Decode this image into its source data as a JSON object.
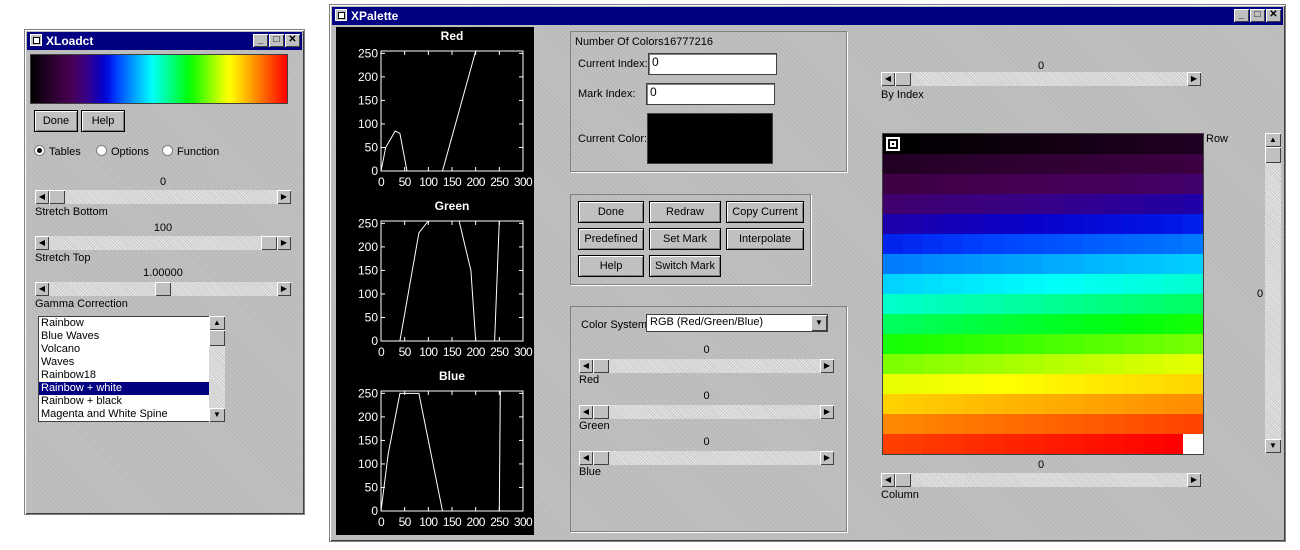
{
  "xloadct": {
    "title": "XLoadct",
    "done_label": "Done",
    "help_label": "Help",
    "radio_tables": "Tables",
    "radio_options": "Options",
    "radio_function": "Function",
    "selected_radio": "Tables",
    "stretch_bottom": {
      "value": "0",
      "label": "Stretch Bottom",
      "fraction": 0.0
    },
    "stretch_top": {
      "value": "100",
      "label": "Stretch Top",
      "fraction": 1.0
    },
    "gamma": {
      "value": "1.00000",
      "label": "Gamma Correction",
      "fraction": 0.5
    },
    "tables": [
      "Rainbow",
      "Blue Waves",
      "Volcano",
      "Waves",
      "Rainbow18",
      "Rainbow + white",
      "Rainbow + black",
      "Magenta and White Spine"
    ],
    "selected_table": "Rainbow + white"
  },
  "xpalette": {
    "title": "XPalette",
    "number_of_colors_label": "Number Of Colors:",
    "number_of_colors": "16777216",
    "current_index_label": "Current Index:",
    "current_index": "0",
    "mark_index_label": "Mark Index:",
    "mark_index": "0",
    "current_color_label": "Current Color:",
    "current_color": "#000000",
    "buttons": {
      "done": "Done",
      "redraw": "Redraw",
      "copy_current": "Copy Current",
      "predefined": "Predefined",
      "set_mark": "Set Mark",
      "interpolate": "Interpolate",
      "help": "Help",
      "switch_mark": "Switch Mark"
    },
    "color_system_label": "Color System:",
    "color_system_value": "RGB  (Red/Green/Blue)",
    "red": {
      "value": "0",
      "label": "Red"
    },
    "green": {
      "value": "0",
      "label": "Green"
    },
    "blue": {
      "value": "0",
      "label": "Blue"
    },
    "by_index": {
      "value": "0",
      "label": "By Index"
    },
    "row_label": "Row",
    "row_value": "0",
    "column": {
      "value": "0",
      "label": "Column"
    }
  },
  "chart_data": [
    {
      "type": "line",
      "title": "Red",
      "xlim": [
        0,
        300
      ],
      "ylim": [
        0,
        255
      ],
      "xticks": [
        "0",
        "50",
        "100",
        "150",
        "200",
        "250",
        "300"
      ],
      "yticks": [
        "0",
        "50",
        "100",
        "150",
        "200",
        "250"
      ],
      "x": [
        0,
        10,
        30,
        40,
        55,
        70,
        130,
        200,
        205,
        260
      ],
      "y": [
        0,
        50,
        85,
        80,
        0,
        0,
        0,
        255,
        255,
        255
      ]
    },
    {
      "type": "line",
      "title": "Green",
      "xlim": [
        0,
        300
      ],
      "ylim": [
        0,
        255
      ],
      "xticks": [
        "0",
        "50",
        "100",
        "150",
        "200",
        "250",
        "300"
      ],
      "yticks": [
        "0",
        "50",
        "100",
        "150",
        "200",
        "250"
      ],
      "x": [
        0,
        40,
        80,
        100,
        165,
        190,
        200,
        235,
        240,
        250,
        255
      ],
      "y": [
        0,
        0,
        230,
        255,
        255,
        150,
        0,
        0,
        0,
        255,
        255
      ]
    },
    {
      "type": "line",
      "title": "Blue",
      "xlim": [
        0,
        300
      ],
      "ylim": [
        0,
        255
      ],
      "xticks": [
        "0",
        "50",
        "100",
        "150",
        "200",
        "250",
        "300"
      ],
      "yticks": [
        "0",
        "50",
        "100",
        "150",
        "200",
        "250"
      ],
      "x": [
        0,
        15,
        40,
        80,
        130,
        140,
        250,
        252
      ],
      "y": [
        0,
        120,
        250,
        250,
        0,
        0,
        0,
        255
      ]
    }
  ],
  "palette_colors": [
    "#000000",
    "#100010",
    "#1e0020",
    "#2c002e",
    "#38003c",
    "#42004a",
    "#46005c",
    "#3f0073",
    "#34008c",
    "#1e00a8",
    "#0a00c8",
    "#0015e6",
    "#0040ff",
    "#0066ff",
    "#008cff",
    "#00b4ff",
    "#00d8ff",
    "#00fffa",
    "#00ffd0",
    "#00ffa0",
    "#00ff70",
    "#00ff40",
    "#00ff10",
    "#20ff00",
    "#50ff00",
    "#80ff00",
    "#b0ff00",
    "#e0ff00",
    "#ffff00",
    "#ffe000",
    "#ffc000",
    "#ffa000",
    "#ff8000",
    "#ff6000",
    "#ff4000",
    "#ff2000",
    "#ff0000",
    "#ffffff"
  ]
}
